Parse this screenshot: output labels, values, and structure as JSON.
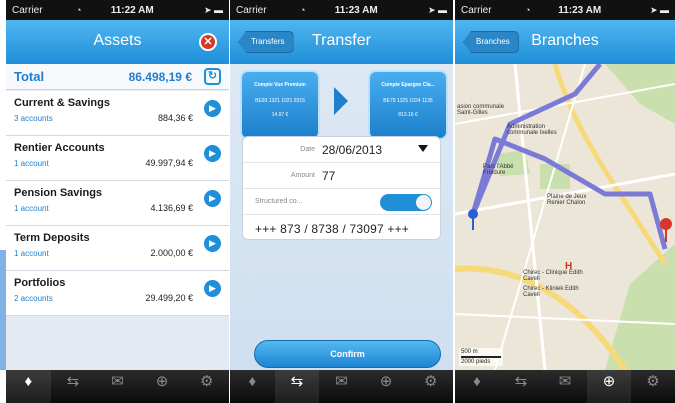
{
  "screens": {
    "assets": {
      "status": {
        "carrier": "Carrier",
        "time": "11:22 AM"
      },
      "title": "Assets",
      "total": {
        "label": "Total",
        "value": "86.498,19 €"
      },
      "accounts": [
        {
          "name": "Current & Savings",
          "count": "3 accounts",
          "amount": "884,36 €"
        },
        {
          "name": "Rentier Accounts",
          "count": "1 account",
          "amount": "49.997,94 €"
        },
        {
          "name": "Pension Savings",
          "count": "1 account",
          "amount": "4.136,69 €"
        },
        {
          "name": "Term Deposits",
          "count": "1 account",
          "amount": "2.000,00 €"
        },
        {
          "name": "Portfolios",
          "count": "2 accounts",
          "amount": "29.499,20 €"
        }
      ]
    },
    "transfer": {
      "status": {
        "carrier": "Carrier",
        "time": "11:23 AM"
      },
      "title": "Transfer",
      "back_label": "Transfers",
      "from": {
        "name": "Compte Vue Premium",
        "iban": "BE93 1321 1021 9315",
        "balance": "14.97 €"
      },
      "to": {
        "name": "Compte Epargne Cla...",
        "iban": "BE79 1325 1024 1135",
        "balance": "813.16 €"
      },
      "date_label": "Date",
      "date_value": "28/06/2013",
      "amount_label": "Amount",
      "amount_value": "77",
      "structured_label": "Structured co...",
      "structured_value": "+++ 873 / 8738 / 73097   +++",
      "confirm_label": "Confirm"
    },
    "branches": {
      "status": {
        "carrier": "Carrier",
        "time": "11:23 AM"
      },
      "title": "Branches",
      "back_label": "Branches",
      "map_labels": [
        "asion communale Saint-Gilles",
        "Administration communale Ixelles",
        "Parc l'Abbé Froidure",
        "Plaine de Jeux Renier Chalon",
        "Chirec - Clinique Edith Cavell",
        "Chirec - Kliniek Edith Cavell"
      ],
      "scale": {
        "m": "500 m",
        "ft": "2000 pieds"
      }
    }
  },
  "tabbar": {
    "items": [
      {
        "icon": "money-bag-icon",
        "glyph": "💰"
      },
      {
        "icon": "transfer-arrows-icon",
        "glyph": "⇆"
      },
      {
        "icon": "envelope-icon",
        "glyph": "✉"
      },
      {
        "icon": "globe-icon",
        "glyph": "⊕"
      },
      {
        "icon": "gear-icon",
        "glyph": "⚙"
      }
    ]
  },
  "colors": {
    "accent": "#1f8fd8",
    "close": "#d9362b",
    "route": "#7b7ad6"
  }
}
